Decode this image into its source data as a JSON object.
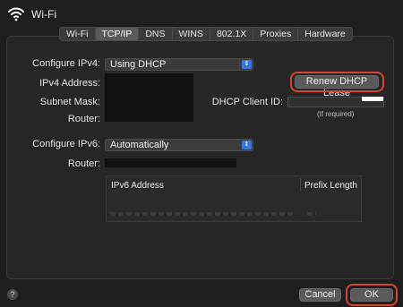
{
  "window": {
    "title": "Wi-Fi"
  },
  "tabs": [
    {
      "label": "Wi-Fi"
    },
    {
      "label": "TCP/IP",
      "active": true
    },
    {
      "label": "DNS"
    },
    {
      "label": "WINS"
    },
    {
      "label": "802.1X"
    },
    {
      "label": "Proxies"
    },
    {
      "label": "Hardware"
    }
  ],
  "ipv4": {
    "configure_label": "Configure IPv4:",
    "configure_value": "Using DHCP",
    "address_label": "IPv4 Address:",
    "subnet_label": "Subnet Mask:",
    "router_label": "Router:"
  },
  "dhcp": {
    "renew_button": "Renew DHCP Lease",
    "client_id_label": "DHCP Client ID:",
    "if_required": "(If required)"
  },
  "ipv6": {
    "configure_label": "Configure IPv6:",
    "configure_value": "Automatically",
    "router_label": "Router:",
    "table_headers": [
      "IPv6 Address",
      "Prefix Length"
    ]
  },
  "footer": {
    "help": "?",
    "cancel": "Cancel",
    "ok": "OK"
  },
  "colors": {
    "accent": "#3778d6",
    "highlight_ring": "#d6452e"
  },
  "icons": {
    "wifi": "wifi-icon",
    "select_arrow": "chevron-up-down-icon",
    "help": "help-icon"
  }
}
